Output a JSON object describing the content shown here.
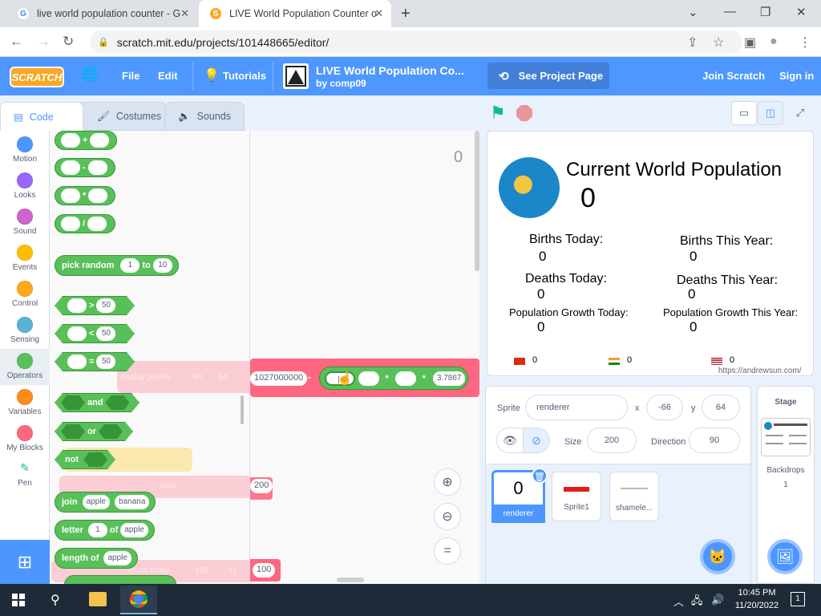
{
  "browser": {
    "tabs": [
      {
        "title": "live world population counter - G",
        "favicon": "G"
      },
      {
        "title": "LIVE World Population Counter o",
        "favicon": "S"
      }
    ],
    "new_tab": "+",
    "window_controls": [
      "⌄",
      "—",
      "❐",
      "✕"
    ],
    "nav": [
      "←",
      "→",
      "↻"
    ],
    "url": "scratch.mit.edu/projects/101448665/editor/",
    "lock": "🔒",
    "right_icons": [
      "⇪",
      "☆",
      "▣",
      "●",
      "⋮"
    ]
  },
  "scratch_menu": {
    "logo": "SCRATCH",
    "globe": "🌐",
    "file": "File",
    "edit": "Edit",
    "tutorials": "Tutorials",
    "project_title": "LIVE World Population Co...",
    "project_author": "by comp09",
    "see_project_page": "See Project Page",
    "join": "Join Scratch",
    "sign_in": "Sign in"
  },
  "editor_tabs": {
    "code": "Code",
    "costumes": "Costumes",
    "sounds": "Sounds"
  },
  "categories": [
    {
      "label": "Motion",
      "color": "#4c97ff"
    },
    {
      "label": "Looks",
      "color": "#9966ff"
    },
    {
      "label": "Sound",
      "color": "#cf63cf"
    },
    {
      "label": "Events",
      "color": "#ffbf00"
    },
    {
      "label": "Control",
      "color": "#ffab19"
    },
    {
      "label": "Sensing",
      "color": "#5cb1d6"
    },
    {
      "label": "Operators",
      "color": "#59c059"
    },
    {
      "label": "Variables",
      "color": "#ff8c1a"
    },
    {
      "label": "My Blocks",
      "color": "#ff6680"
    },
    {
      "label": "Pen",
      "color": "#0fbd8c"
    }
  ],
  "palette": {
    "ops": [
      "+",
      "-",
      "*",
      "/"
    ],
    "pick_random": {
      "label": "pick random",
      "from": "1",
      "to_label": "to",
      "to": "10"
    },
    "compare": [
      {
        "op": ">",
        "value": "50"
      },
      {
        "op": "<",
        "value": "50"
      },
      {
        "op": "=",
        "value": "50"
      }
    ],
    "and": "and",
    "or": "or",
    "not": "not",
    "join": {
      "label": "join",
      "a": "apple",
      "b": "banana"
    },
    "letter": {
      "label": "letter",
      "n": "1",
      "of": "of",
      "word": "apple"
    },
    "length": {
      "label": "length of",
      "word": "apple"
    },
    "ghost_texts": {
      "display": "display pixeler",
      "g1": "-90",
      "g2": "64",
      "total": "total",
      "births": "births today",
      "b1": "-159",
      "b2": "-11"
    }
  },
  "script": {
    "corner_value": "0",
    "drag_number": "1027000000",
    "drag_minus": "-",
    "drag_mul1": "*",
    "drag_mul2": "*",
    "drag_const": "3.7867",
    "red_val_1": "200",
    "red_val_2": "100",
    "zoom_in": "⊕",
    "zoom_out": "⊖",
    "zoom_reset": "="
  },
  "stage_controls": {
    "flag": "⚑",
    "stop": "⬣",
    "small": "▭",
    "normal": "◫",
    "full": "⤢"
  },
  "stage": {
    "title": "Current World Population",
    "population": "0",
    "births_today_label": "Births Today:",
    "births_today": "0",
    "births_year_label": "Births This Year:",
    "births_year": "0",
    "deaths_today_label": "Deaths Today:",
    "deaths_today": "0",
    "deaths_year_label": "Deaths This Year:",
    "deaths_year": "0",
    "growth_today_label": "Population Growth Today:",
    "growth_today": "0",
    "growth_year_label": "Population Growth This Year:",
    "growth_year": "0",
    "flags": [
      {
        "value": "0"
      },
      {
        "value": "0"
      },
      {
        "value": "0"
      }
    ],
    "credit": "https://andrewsun.com/"
  },
  "sprite_info": {
    "sprite_label": "Sprite",
    "sprite_name": "renderer",
    "x_label": "x",
    "x": "-66",
    "y_label": "y",
    "y": "64",
    "show_label": "Show",
    "size_label": "Size",
    "size": "200",
    "direction_label": "Direction",
    "direction": "90"
  },
  "sprites": [
    {
      "name": "renderer",
      "thumb": "0"
    },
    {
      "name": "Sprite1",
      "thumb": ""
    },
    {
      "name": "shamele...",
      "thumb": ""
    }
  ],
  "stage_panel": {
    "label": "Stage",
    "backdrops_label": "Backdrops",
    "backdrops": "1"
  },
  "taskbar": {
    "time": "10:45 PM",
    "date": "11/20/2022",
    "notif": "1"
  }
}
